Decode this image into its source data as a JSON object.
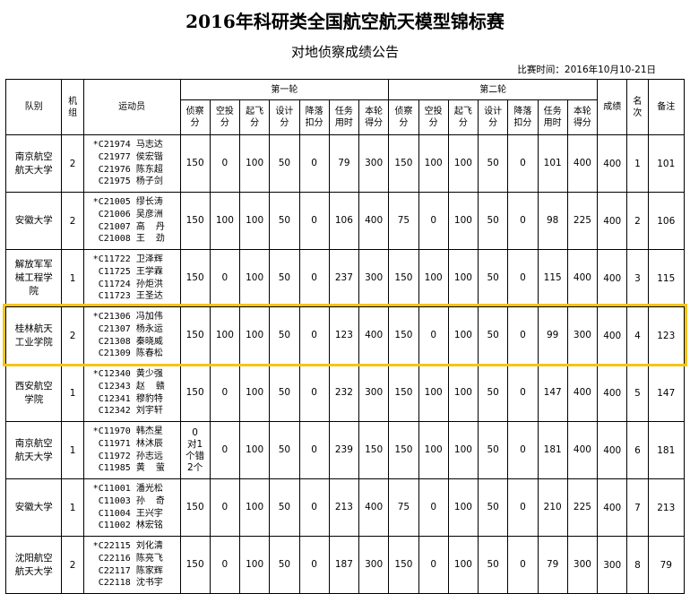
{
  "header": {
    "title": "2016年科研类全国航空航天模型锦标赛",
    "subtitle": "对地侦察成绩公告",
    "date": "比赛时间：2016年10月10-21日"
  },
  "columns": {
    "team": "队别",
    "plane_group": "机\n组",
    "athletes": "运动员",
    "round1": "第一轮",
    "round2": "第二轮",
    "scores_r1": [
      "侦察\n分",
      "空投\n分",
      "起飞\n分",
      "设计\n分",
      "降落\n扣分",
      "任务\n用时",
      "本轮\n得分"
    ],
    "scores_r2": [
      "侦察\n分",
      "空投\n分",
      "起飞\n分",
      "设计\n分",
      "降落\n扣分",
      "任务\n用时",
      "本轮\n得分"
    ],
    "total": "成绩",
    "rank": "名\n次",
    "note": "备注"
  },
  "rows": [
    {
      "team": "南京航空\n航天大学",
      "group": "2",
      "athletes": "*C21974 马志达\n C21977 侯宏锴\n C21976 陈东超\n C21975 杨子剑",
      "r1": [
        "150",
        "0",
        "100",
        "50",
        "0",
        "79",
        "300"
      ],
      "r2": [
        "150",
        "100",
        "100",
        "50",
        "0",
        "101",
        "400"
      ],
      "total": "400",
      "rank": "1",
      "note": "101"
    },
    {
      "team": "安徽大学",
      "group": "2",
      "athletes": "*C21005 缪长涛\n C21006 吴彦洲\n C21007 高  丹\n C21008 王  劲",
      "r1": [
        "150",
        "100",
        "100",
        "50",
        "0",
        "106",
        "400"
      ],
      "r2": [
        "75",
        "0",
        "100",
        "50",
        "0",
        "98",
        "225"
      ],
      "total": "400",
      "rank": "2",
      "note": "106"
    },
    {
      "team": "解放军军\n械工程学\n院",
      "group": "1",
      "athletes": "*C11722 卫泽辉\n C11725 王学霖\n C11724 孙炬洪\n C11723 王圣达",
      "r1": [
        "150",
        "0",
        "100",
        "50",
        "0",
        "237",
        "300"
      ],
      "r2": [
        "150",
        "100",
        "100",
        "50",
        "0",
        "115",
        "400"
      ],
      "total": "400",
      "rank": "3",
      "note": "115"
    },
    {
      "team": "桂林航天\n工业学院",
      "group": "2",
      "athletes": "*C21306 冯加伟\n C21307 杨永运\n C21308 秦晓威\n C21309 陈春松",
      "r1": [
        "150",
        "100",
        "100",
        "50",
        "0",
        "123",
        "400"
      ],
      "r2": [
        "150",
        "0",
        "100",
        "50",
        "0",
        "99",
        "300"
      ],
      "total": "400",
      "rank": "4",
      "note": "123"
    },
    {
      "team": "西安航空\n学院",
      "group": "1",
      "athletes": "*C12340 黄少强\n C12343 赵  赣\n C12341 穆豹特\n C12342 刘宇轩",
      "r1": [
        "150",
        "0",
        "100",
        "50",
        "0",
        "232",
        "300"
      ],
      "r2": [
        "150",
        "100",
        "100",
        "50",
        "0",
        "147",
        "400"
      ],
      "total": "400",
      "rank": "5",
      "note": "147"
    },
    {
      "team": "南京航空\n航天大学",
      "group": "1",
      "athletes": "*C11970 韩杰星\n C11971 林沐辰\n C11972 孙志远\n C11985 黄  萤",
      "r1": [
        "0\n对1\n个错\n2个",
        "0",
        "100",
        "50",
        "0",
        "239",
        "150"
      ],
      "r2": [
        "150",
        "100",
        "100",
        "50",
        "0",
        "181",
        "400"
      ],
      "total": "400",
      "rank": "6",
      "note": "181"
    },
    {
      "team": "安徽大学",
      "group": "1",
      "athletes": "*C11001 潘光松\n C11003 孙  奇\n C11004 王兴宇\n C11002 林宏铭",
      "r1": [
        "150",
        "0",
        "100",
        "50",
        "0",
        "213",
        "400"
      ],
      "r2": [
        "75",
        "0",
        "100",
        "50",
        "0",
        "210",
        "225"
      ],
      "total": "400",
      "rank": "7",
      "note": "213"
    },
    {
      "team": "沈阳航空\n航天大学",
      "group": "2",
      "athletes": "*C22115 刘化清\n C22116 陈亮飞\n C22117 陈家辉\n C22118 沈书宇",
      "r1": [
        "150",
        "0",
        "100",
        "50",
        "0",
        "187",
        "300"
      ],
      "r2": [
        "150",
        "0",
        "100",
        "50",
        "0",
        "79",
        "300"
      ],
      "total": "300",
      "rank": "8",
      "note": "79"
    }
  ],
  "highlight_color": "#f5c518"
}
